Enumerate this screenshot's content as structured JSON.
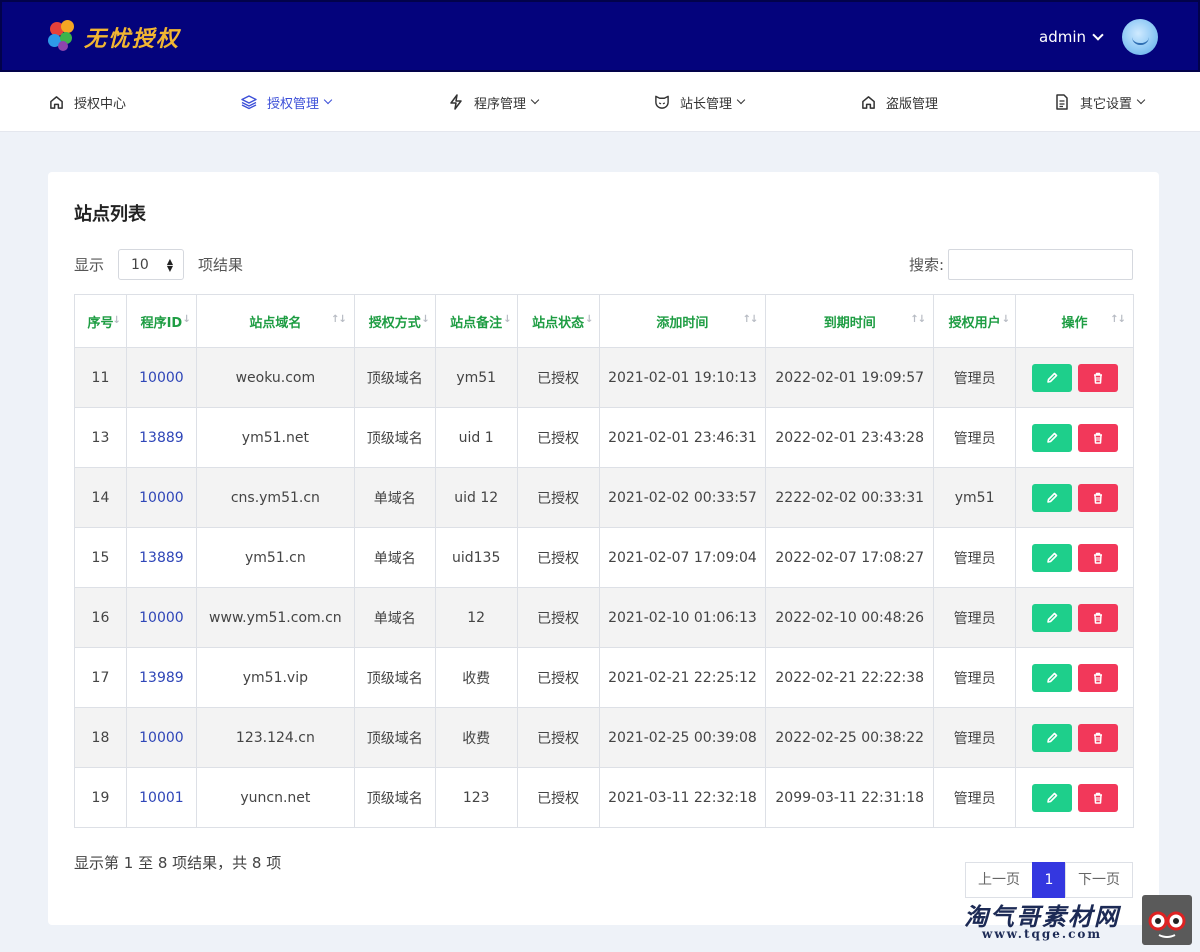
{
  "brand": {
    "name": "无忧授权"
  },
  "user": {
    "name": "admin"
  },
  "nav": [
    {
      "label": "授权中心",
      "icon": "home-icon",
      "dropdown": false,
      "active": false
    },
    {
      "label": "授权管理",
      "icon": "layers-icon",
      "dropdown": true,
      "active": true
    },
    {
      "label": "程序管理",
      "icon": "lightning-icon",
      "dropdown": true,
      "active": false
    },
    {
      "label": "站长管理",
      "icon": "mask-icon",
      "dropdown": true,
      "active": false
    },
    {
      "label": "盗版管理",
      "icon": "home-icon",
      "dropdown": false,
      "active": false
    },
    {
      "label": "其它设置",
      "icon": "document-icon",
      "dropdown": true,
      "active": false
    }
  ],
  "card": {
    "title": "站点列表",
    "length": {
      "prefix": "显示",
      "value": "10",
      "suffix": "项结果"
    },
    "search_label": "搜索:",
    "info": "显示第 1 至 8 项结果，共 8 项"
  },
  "table": {
    "columns": [
      "序号",
      "程序ID",
      "站点域名",
      "授权方式",
      "站点备注",
      "站点状态",
      "添加时间",
      "到期时间",
      "授权用户",
      "操作"
    ],
    "rows": [
      [
        "11",
        "10000",
        "weoku.com",
        "顶级域名",
        "ym51",
        "已授权",
        "2021-02-01 19:10:13",
        "2022-02-01 19:09:57",
        "管理员"
      ],
      [
        "13",
        "13889",
        "ym51.net",
        "顶级域名",
        "uid 1",
        "已授权",
        "2021-02-01 23:46:31",
        "2022-02-01 23:43:28",
        "管理员"
      ],
      [
        "14",
        "10000",
        "cns.ym51.cn",
        "单域名",
        "uid 12",
        "已授权",
        "2021-02-02 00:33:57",
        "2222-02-02 00:33:31",
        "ym51"
      ],
      [
        "15",
        "13889",
        "ym51.cn",
        "单域名",
        "uid135",
        "已授权",
        "2021-02-07 17:09:04",
        "2022-02-07 17:08:27",
        "管理员"
      ],
      [
        "16",
        "10000",
        "www.ym51.com.cn",
        "单域名",
        "12",
        "已授权",
        "2021-02-10 01:06:13",
        "2022-02-10 00:48:26",
        "管理员"
      ],
      [
        "17",
        "13989",
        "ym51.vip",
        "顶级域名",
        "收费",
        "已授权",
        "2021-02-21 22:25:12",
        "2022-02-21 22:22:38",
        "管理员"
      ],
      [
        "18",
        "10000",
        "123.124.cn",
        "顶级域名",
        "收费",
        "已授权",
        "2021-02-25 00:39:08",
        "2022-02-25 00:38:22",
        "管理员"
      ],
      [
        "19",
        "10001",
        "yuncn.net",
        "顶级域名",
        "123",
        "已授权",
        "2021-03-11 22:32:18",
        "2099-03-11 22:31:18",
        "管理员"
      ]
    ]
  },
  "pager": {
    "prev": "上一页",
    "current": "1",
    "next": "下一页"
  },
  "watermark": {
    "text": "淘气哥素材网",
    "url": "www.tqge.com"
  },
  "colors": {
    "header": "#04037c",
    "accent": "#3437e0",
    "header_text": "#1e9d43",
    "edit": "#1ecf8b",
    "delete": "#f2385a",
    "id_link": "#2f46b8"
  }
}
